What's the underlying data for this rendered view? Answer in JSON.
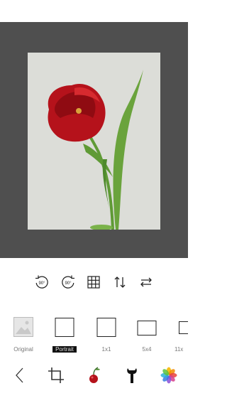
{
  "toolbar": {
    "rotate_left_label": "90°",
    "rotate_right_label": "90°",
    "icons": [
      "rotate-left-90-icon",
      "rotate-right-90-icon",
      "grid-icon",
      "flip-vertical-icon",
      "flip-horizontal-icon"
    ]
  },
  "ratios": [
    {
      "label": "Original",
      "selected": false
    },
    {
      "label": "Portrait",
      "selected": true
    },
    {
      "label": "1x1",
      "selected": false
    },
    {
      "label": "5x4",
      "selected": false
    },
    {
      "label": "11x",
      "selected": false
    }
  ],
  "bottom_nav": {
    "icons": [
      "back-icon",
      "crop-icon",
      "cherry-icon",
      "wrench-icon",
      "photos-icon"
    ]
  },
  "colors": {
    "canvas": "#4f4f4f",
    "photo_bg": "#dcddd8",
    "tulip": "#b5121b",
    "stem": "#6aa33c"
  }
}
